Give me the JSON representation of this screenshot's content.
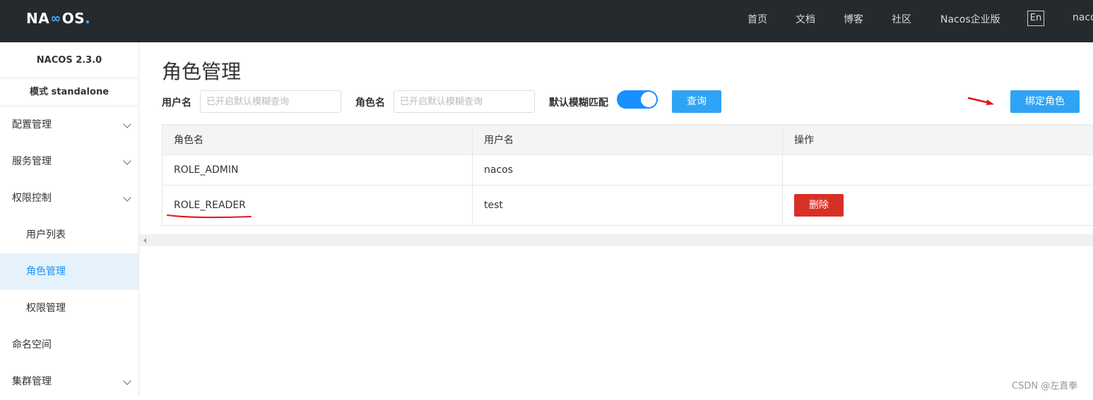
{
  "header": {
    "logo": {
      "pre": "NA",
      "post": "OS",
      "dot": "."
    },
    "nav": [
      "首页",
      "文档",
      "博客",
      "社区",
      "Nacos企业版"
    ],
    "lang": "En",
    "user": "naco"
  },
  "sidebar": {
    "version": "NACOS 2.3.0",
    "mode": "模式 standalone",
    "items": [
      {
        "label": "配置管理",
        "expandable": true
      },
      {
        "label": "服务管理",
        "expandable": true
      },
      {
        "label": "权限控制",
        "expandable": true
      },
      {
        "label": "用户列表",
        "sub": true
      },
      {
        "label": "角色管理",
        "sub": true,
        "active": true
      },
      {
        "label": "权限管理",
        "sub": true
      },
      {
        "label": "命名空间"
      },
      {
        "label": "集群管理",
        "expandable": true
      }
    ]
  },
  "main": {
    "title": "角色管理",
    "search": {
      "username_label": "用户名",
      "username_placeholder": "已开启默认模糊查询",
      "rolename_label": "角色名",
      "rolename_placeholder": "已开启默认模糊查询",
      "fuzzy_label": "默认模糊匹配",
      "fuzzy_on": true,
      "query_button": "查询"
    },
    "bind_button": "绑定角色",
    "table": {
      "headers": [
        "角色名",
        "用户名",
        "操作"
      ],
      "rows": [
        {
          "role": "ROLE_ADMIN",
          "user": "nacos",
          "action": ""
        },
        {
          "role": "ROLE_READER",
          "user": "test",
          "action": "删除"
        }
      ]
    }
  },
  "watermark": "CSDN @左直拳",
  "colors": {
    "primary": "#2fa4f5",
    "danger": "#d93026",
    "topbar": "#252a2f",
    "annotation": "#e8121b"
  }
}
